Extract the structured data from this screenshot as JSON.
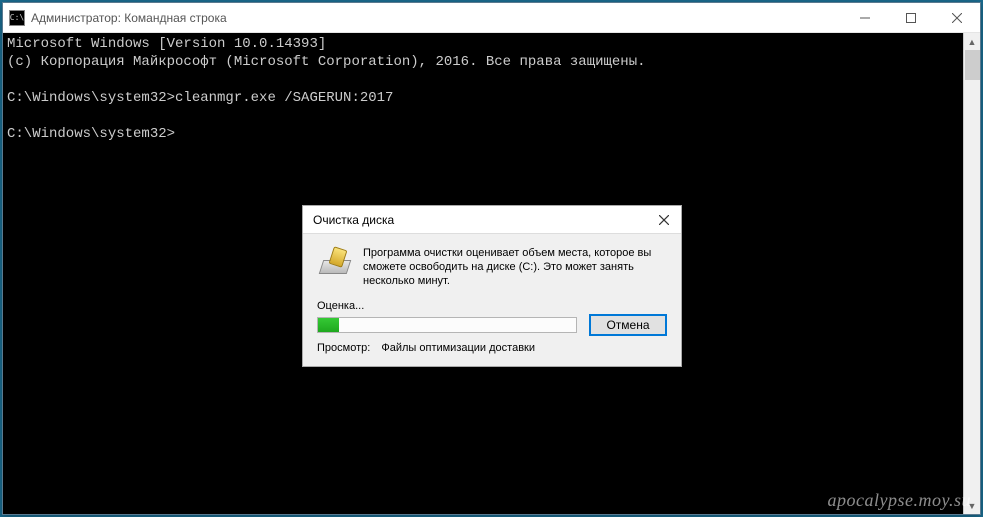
{
  "window": {
    "title": "Администратор: Командная строка"
  },
  "console": {
    "lines": [
      "Microsoft Windows [Version 10.0.14393]",
      "(c) Корпорация Майкрософт (Microsoft Corporation), 2016. Все права защищены.",
      "",
      "C:\\Windows\\system32>cleanmgr.exe /SAGERUN:2017",
      "",
      "C:\\Windows\\system32>"
    ]
  },
  "dialog": {
    "title": "Очистка диска",
    "message": "Программа очистки оценивает объем места, которое вы сможете освободить на диске  (C:). Это может занять несколько минут.",
    "progress_label": "Оценка...",
    "progress_percent": 8,
    "cancel_label": "Отмена",
    "status_label": "Просмотр:",
    "status_value": "Файлы оптимизации доставки"
  },
  "watermark": "apocalypse.moy.su"
}
